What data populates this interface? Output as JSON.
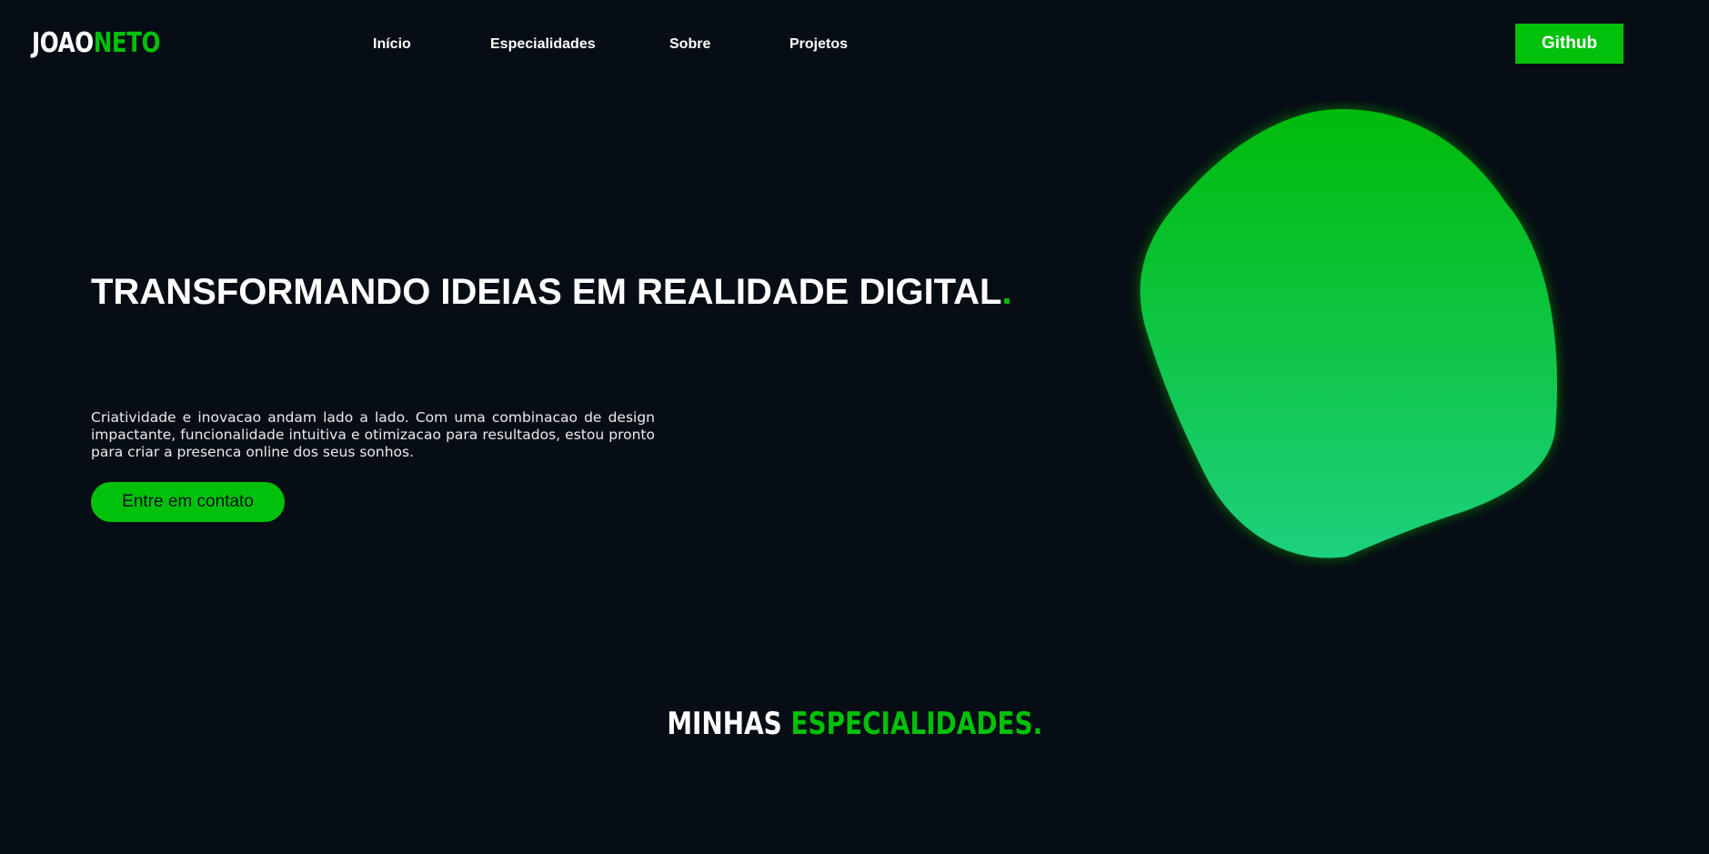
{
  "brand": {
    "logo_first": "JOAO",
    "logo_second": "NETO"
  },
  "nav": {
    "items": [
      {
        "label": "Início"
      },
      {
        "label": "Especialidades"
      },
      {
        "label": "Sobre"
      },
      {
        "label": "Projetos"
      }
    ],
    "github_label": "Github"
  },
  "hero": {
    "title": "TRANSFORMANDO IDEIAS EM REALIDADE DIGITAL",
    "title_dot": ".",
    "description": "Criatividade e inovacao andam lado a lado. Com uma combinacao de design impactante, funcionalidade intuitiva e otimizacao para resultados, estou pronto para criar a presenca online dos seus sonhos.",
    "cta_label": "Entre em contato"
  },
  "specialties": {
    "title_part1": "MINHAS",
    "title_part2": "ESPECIALIDADES."
  },
  "colors": {
    "background": "#070d14",
    "accent": "#00c10a",
    "blob_top": "#00bb0a",
    "blob_bottom": "#1dd07e",
    "text": "#ffffff"
  }
}
